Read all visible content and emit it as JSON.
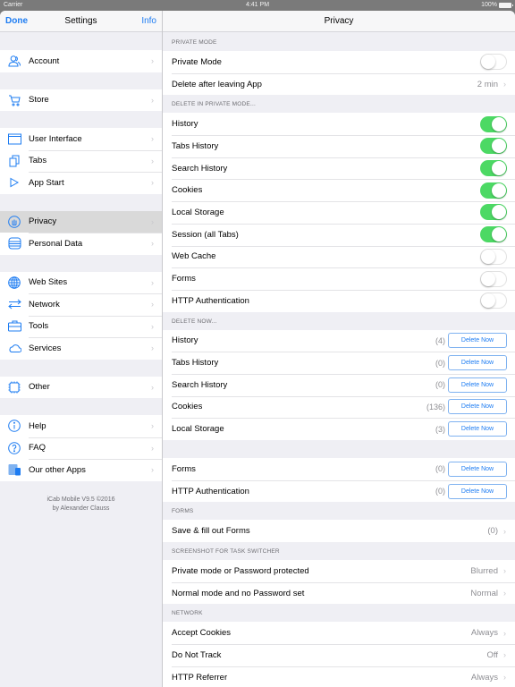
{
  "status_bar": {
    "carrier": "Carrier",
    "time": "4:41 PM",
    "battery": "100%"
  },
  "master": {
    "done_label": "Done",
    "title": "Settings",
    "info_label": "Info",
    "groups": [
      [
        {
          "label": "Account",
          "icon": "account-icon"
        }
      ],
      [
        {
          "label": "Store",
          "icon": "cart-icon"
        }
      ],
      [
        {
          "label": "User Interface",
          "icon": "window-icon"
        },
        {
          "label": "Tabs",
          "icon": "tabs-icon"
        },
        {
          "label": "App Start",
          "icon": "play-icon"
        }
      ],
      [
        {
          "label": "Privacy",
          "icon": "privacy-hand-icon",
          "selected": true
        },
        {
          "label": "Personal Data",
          "icon": "database-icon"
        }
      ],
      [
        {
          "label": "Web Sites",
          "icon": "globe-icon"
        },
        {
          "label": "Network",
          "icon": "arrows-icon"
        },
        {
          "label": "Tools",
          "icon": "toolbox-icon"
        },
        {
          "label": "Services",
          "icon": "cloud-icon"
        }
      ],
      [
        {
          "label": "Other",
          "icon": "chip-icon"
        }
      ],
      [
        {
          "label": "Help",
          "icon": "info-icon"
        },
        {
          "label": "FAQ",
          "icon": "question-icon"
        },
        {
          "label": "Our other Apps",
          "icon": "devices-icon"
        }
      ]
    ],
    "footer_line1": "iCab Mobile V9.5 ©2016",
    "footer_line2": "by Alexander Clauss"
  },
  "detail": {
    "title": "Privacy",
    "delete_now_label": "Delete Now",
    "private_mode": {
      "header": "PRIVATE MODE",
      "toggle_label": "Private Mode",
      "toggle_on": false,
      "delete_after_label": "Delete after leaving App",
      "delete_after_value": "2 min"
    },
    "delete_in_private": {
      "header": "DELETE IN PRIVATE MODE...",
      "items": [
        {
          "label": "History",
          "on": true
        },
        {
          "label": "Tabs History",
          "on": true
        },
        {
          "label": "Search History",
          "on": true
        },
        {
          "label": "Cookies",
          "on": true
        },
        {
          "label": "Local Storage",
          "on": true
        },
        {
          "label": "Session (all Tabs)",
          "on": true
        },
        {
          "label": "Web Cache",
          "on": false
        },
        {
          "label": "Forms",
          "on": false
        },
        {
          "label": "HTTP Authentication",
          "on": false
        }
      ]
    },
    "delete_now": {
      "header": "DELETE NOW...",
      "items": [
        {
          "label": "History",
          "count": "(4)"
        },
        {
          "label": "Tabs History",
          "count": "(0)"
        },
        {
          "label": "Search History",
          "count": "(0)"
        },
        {
          "label": "Cookies",
          "count": "(136)"
        },
        {
          "label": "Local Storage",
          "count": "(3)"
        }
      ],
      "items2": [
        {
          "label": "Forms",
          "count": "(0)"
        },
        {
          "label": "HTTP Authentication",
          "count": "(0)"
        }
      ]
    },
    "forms": {
      "header": "FORMS",
      "label": "Save & fill out Forms",
      "value": "(0)"
    },
    "screenshot": {
      "header": "SCREENSHOT FOR TASK SWITCHER",
      "items": [
        {
          "label": "Private mode or Password protected",
          "value": "Blurred"
        },
        {
          "label": "Normal mode and no Password set",
          "value": "Normal"
        }
      ]
    },
    "network": {
      "header": "NETWORK",
      "items": [
        {
          "label": "Accept Cookies",
          "value": "Always"
        },
        {
          "label": "Do Not Track",
          "value": "Off"
        },
        {
          "label": "HTTP Referrer",
          "value": "Always"
        }
      ]
    }
  },
  "colors": {
    "accent": "#1d7cf2",
    "toggle_on": "#4cd964",
    "background": "#efeff4"
  }
}
